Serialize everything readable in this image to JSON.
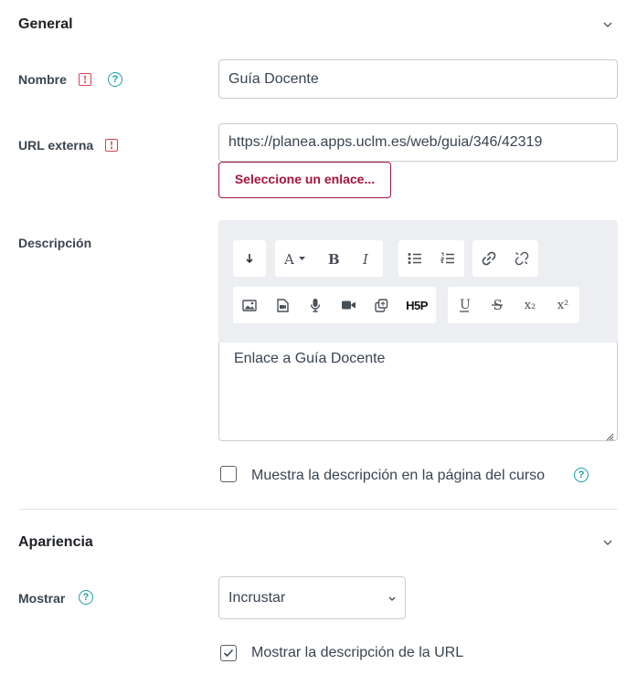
{
  "general": {
    "title": "General",
    "nombre": {
      "label": "Nombre",
      "value": "Guía Docente"
    },
    "url": {
      "label": "URL externa",
      "value": "https://planea.apps.uclm.es/web/guia/346/42319",
      "choose_link": "Seleccione un enlace..."
    },
    "descripcion": {
      "label": "Descripción",
      "content": "Enlace a Guía Docente",
      "toolbar_row1": [
        "collapse-icon",
        "font-color-icon",
        "bold-icon",
        "italic-icon",
        "unordered-list-icon",
        "ordered-list-icon",
        "link-icon",
        "unlink-icon"
      ],
      "toolbar_row2": [
        "image-icon",
        "media-file-icon",
        "microphone-icon",
        "video-camera-icon",
        "copy-icon",
        "h5p-icon",
        "underline-icon",
        "strikethrough-icon",
        "subscript-icon",
        "superscript-icon"
      ],
      "h5p": "H5P",
      "sub": "x₂",
      "sup": "x²"
    },
    "show_description": {
      "label": "Muestra la descripción en la página del curso",
      "checked": false
    }
  },
  "apariencia": {
    "title": "Apariencia",
    "mostrar": {
      "label": "Mostrar",
      "value": "Incrustar"
    },
    "show_url_description": {
      "label": "Mostrar la descripción de la URL",
      "checked": true
    }
  },
  "colors": {
    "accent": "#a8123f",
    "help": "#1a9fa6",
    "required": "#d9414f"
  }
}
